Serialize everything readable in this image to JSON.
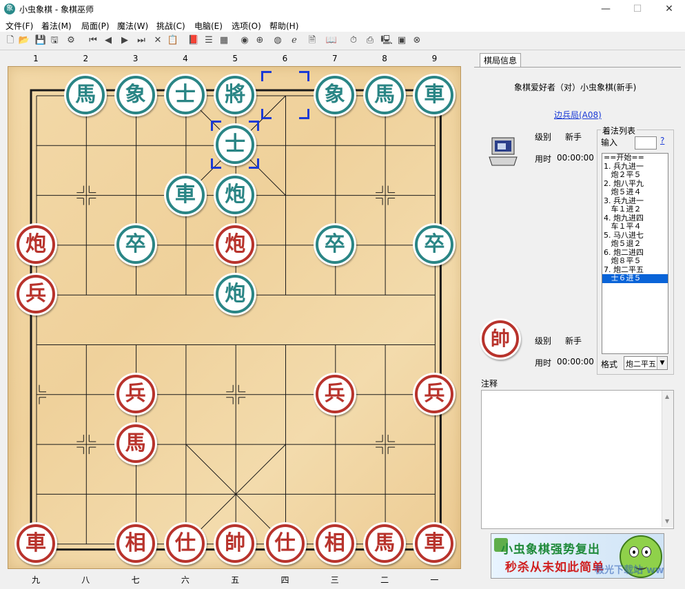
{
  "window": {
    "title": "小虫象棋 - 象棋巫师",
    "app_icon": "象",
    "minimize": "—",
    "maximize": "☐",
    "close": "✕"
  },
  "menu": [
    "文件(F)",
    "着法(M)",
    "局面(P)",
    "魔法(W)",
    "挑战(C)",
    "电脑(E)",
    "选项(O)",
    "帮助(H)"
  ],
  "toolbar_icons": [
    "new-icon",
    "open-icon",
    "save-icon",
    "print-icon",
    "settings-icon",
    "first-move-icon",
    "prev-move-icon",
    "next-move-icon",
    "last-move-icon",
    "delete-icon",
    "paste-icon",
    "book-icon",
    "tree-icon",
    "calc-icon",
    "color-icon",
    "globe-icon",
    "weibo-icon",
    "ie-icon",
    "notes-icon",
    "library-icon",
    "clock-icon",
    "printer-icon",
    "computer-icon",
    "monitor-icon",
    "stop-icon"
  ],
  "coords": {
    "top": [
      "1",
      "2",
      "3",
      "4",
      "5",
      "6",
      "7",
      "8",
      "9"
    ],
    "bottom": [
      "九",
      "八",
      "七",
      "六",
      "五",
      "四",
      "三",
      "二",
      "一"
    ]
  },
  "pieces": [
    {
      "char": "馬",
      "side": "black",
      "col": 1,
      "row": 0
    },
    {
      "char": "象",
      "side": "black",
      "col": 2,
      "row": 0
    },
    {
      "char": "士",
      "side": "black",
      "col": 3,
      "row": 0
    },
    {
      "char": "將",
      "side": "black",
      "col": 4,
      "row": 0
    },
    {
      "char": "象",
      "side": "black",
      "col": 6,
      "row": 0
    },
    {
      "char": "馬",
      "side": "black",
      "col": 7,
      "row": 0
    },
    {
      "char": "車",
      "side": "black",
      "col": 8,
      "row": 0
    },
    {
      "char": "士",
      "side": "black",
      "col": 4,
      "row": 1
    },
    {
      "char": "車",
      "side": "black",
      "col": 3,
      "row": 2
    },
    {
      "char": "炮",
      "side": "black",
      "col": 4,
      "row": 2
    },
    {
      "char": "卒",
      "side": "black",
      "col": 2,
      "row": 3
    },
    {
      "char": "卒",
      "side": "black",
      "col": 6,
      "row": 3
    },
    {
      "char": "卒",
      "side": "black",
      "col": 8,
      "row": 3
    },
    {
      "char": "炮",
      "side": "black",
      "col": 4,
      "row": 4
    },
    {
      "char": "炮",
      "side": "red",
      "col": 0,
      "row": 3
    },
    {
      "char": "炮",
      "side": "red",
      "col": 4,
      "row": 3
    },
    {
      "char": "兵",
      "side": "red",
      "col": 0,
      "row": 4
    },
    {
      "char": "兵",
      "side": "red",
      "col": 2,
      "row": 6
    },
    {
      "char": "兵",
      "side": "red",
      "col": 6,
      "row": 6
    },
    {
      "char": "兵",
      "side": "red",
      "col": 8,
      "row": 6
    },
    {
      "char": "馬",
      "side": "red",
      "col": 2,
      "row": 7
    },
    {
      "char": "車",
      "side": "red",
      "col": 0,
      "row": 9
    },
    {
      "char": "相",
      "side": "red",
      "col": 2,
      "row": 9
    },
    {
      "char": "仕",
      "side": "red",
      "col": 3,
      "row": 9
    },
    {
      "char": "帥",
      "side": "red",
      "col": 4,
      "row": 9
    },
    {
      "char": "仕",
      "side": "red",
      "col": 5,
      "row": 9
    },
    {
      "char": "相",
      "side": "red",
      "col": 6,
      "row": 9
    },
    {
      "char": "馬",
      "side": "red",
      "col": 7,
      "row": 9
    },
    {
      "char": "車",
      "side": "red",
      "col": 8,
      "row": 9
    }
  ],
  "selection_markers": [
    {
      "col": 5,
      "row": 0
    },
    {
      "col": 4,
      "row": 1
    }
  ],
  "panel": {
    "tab": "棋局信息",
    "match": "象棋爱好者（对）小虫象棋(新手)",
    "opening": "边兵局(A08)",
    "top_player": {
      "level_label": "级别",
      "level": "新手",
      "time_label": "用时",
      "time": "00:00:00"
    },
    "bottom_player": {
      "badge": "帥",
      "level_label": "级别",
      "level": "新手",
      "time_label": "用时",
      "time": "00:00:00"
    },
    "moves_title": "着法列表",
    "input_label": "输入",
    "help": "?",
    "moves": [
      "==开始==",
      "1. 兵九进一",
      "   炮２平５",
      "2. 炮八平九",
      "   炮５进４",
      "3. 兵九进一",
      "   车１进２",
      "4. 炮九进四",
      "   车１平４",
      "5. 马八进七",
      "   炮５退２",
      "6. 炮二进四",
      "   炮８平５",
      "7. 炮二平五",
      "   士６进５"
    ],
    "selected_move": 14,
    "format_label": "格式",
    "format_value": "炮二平五",
    "notes_label": "注释"
  },
  "ad": {
    "line1": "小虫象棋强势复出",
    "line2": "秒杀从未如此简单",
    "watermark": "极光下载站 www.xz7.com"
  }
}
